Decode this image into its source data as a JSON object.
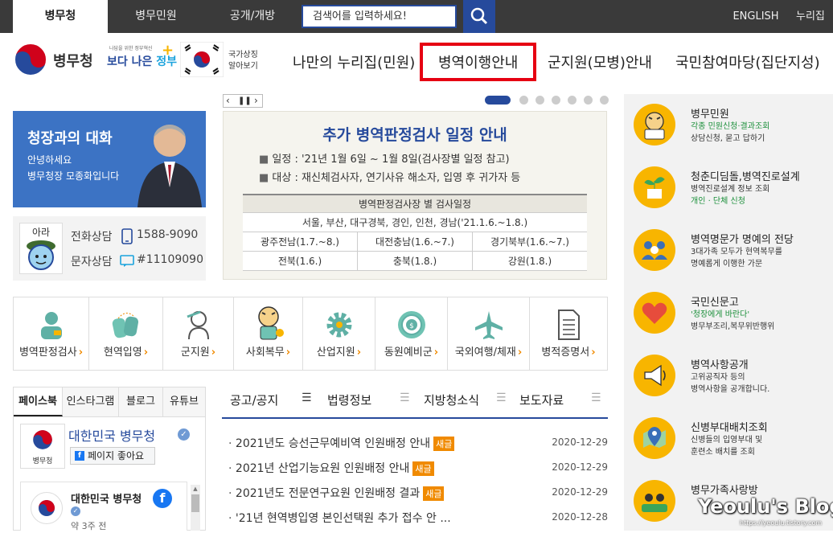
{
  "topbar": {
    "tabs": [
      "병무청",
      "병무민원",
      "공개/개방"
    ],
    "search_placeholder": "검색어를 입력하세요!",
    "english": "ENGLISH",
    "nuri": "누리집"
  },
  "header": {
    "logo_text": "병무청",
    "slogan_small": "나답을 위한 정부혁신",
    "slogan_big_a": "보다 나은 ",
    "slogan_big_b": "정부",
    "symbol_line1": "국가상징",
    "symbol_line2": "알아보기",
    "nav": [
      "나만의 누리집(민원)",
      "병역이행안내",
      "군지원(모병)안내",
      "국민참여마당(집단지성)"
    ]
  },
  "banner": {
    "title": "청장과의 대화",
    "line1": "안녕하세요",
    "line2": "병무청장 모종화입니다"
  },
  "contact": {
    "avatar_label": "아라",
    "phone_label": "전화상담",
    "phone": "1588-9090",
    "sms_label": "문자상담",
    "sms": "#11109090"
  },
  "slider": {
    "title": "추가 병역판정검사 일정 안내",
    "bullet1": "일정 : '21년 1월 6일 ~ 1월 8일(검사장별 일정 참고)",
    "bullet2": "대상 : 재신체검사자, 연기사유 해소자, 입영 후 귀가자 등",
    "table_title": "병역판정검사장 별 검사일정",
    "table_row1": "서울, 부산, 대구경북, 경인, 인천, 경남('21.1.6.~1.8.)",
    "table_grid": [
      [
        "광주전남(1.7.~8.)",
        "대전충남(1.6.~7.)",
        "경기북부(1.6.~7.)"
      ],
      [
        "전북(1.6.)",
        "충북(1.8.)",
        "강원(1.8.)"
      ]
    ]
  },
  "services": [
    {
      "label": "병역판정검사",
      "icon": "person-icon"
    },
    {
      "label": "현역입영",
      "icon": "dogtag-icon"
    },
    {
      "label": "군지원",
      "icon": "salute-icon"
    },
    {
      "label": "사회복무",
      "icon": "tiger-mascot-icon"
    },
    {
      "label": "산업지원",
      "icon": "gear-icon"
    },
    {
      "label": "동원예비군",
      "icon": "medal-icon"
    },
    {
      "label": "국외여행/체재",
      "icon": "airplane-icon"
    },
    {
      "label": "병적증명서",
      "icon": "document-icon"
    }
  ],
  "sns": {
    "tabs": [
      "페이스북",
      "인스타그램",
      "블로그",
      "유튜브"
    ],
    "page_name": "대한민국 병무청",
    "like": "페이지 좋아요",
    "logo_caption": "병무청",
    "post_name": "대한민국 병무청",
    "post_time": "약 3주 전"
  },
  "board": {
    "tabs": [
      "공고/공지",
      "법령정보",
      "지방청소식",
      "보도자료"
    ],
    "new_badge": "새글",
    "items": [
      {
        "title": "2021년도 승선근무예비역 인원배정 안내",
        "date": "2020-12-29",
        "new": true
      },
      {
        "title": "2021년 산업기능요원 인원배정 안내",
        "date": "2020-12-29",
        "new": true
      },
      {
        "title": "2021년도 전문연구요원 인원배정 결과",
        "date": "2020-12-29",
        "new": true
      },
      {
        "title": "'21년 현역병입영 본인선택원 추가 접수 안 ...",
        "date": "2020-12-28",
        "new": false
      }
    ]
  },
  "right": [
    {
      "title": "병무민원",
      "desc1": "각종 민원신청·결과조회",
      "desc2": "상담신청, 묻고 답하기",
      "icon": "tiger-mascot-icon"
    },
    {
      "title": "청춘디딤돌,병역진로설계",
      "desc1": "병역진로설계 정보 조회",
      "desc2": "개인 · 단체 신청",
      "icon": "sprout-icon"
    },
    {
      "title": "병역명문가 명예의 전당",
      "desc1": "3대가족 모두가 현역복무를",
      "desc2": "명예롭게 이행한 가문",
      "icon": "family-icon"
    },
    {
      "title": "국민신문고",
      "desc1": "'청장에게 바란다'",
      "desc2": "병무부조리,복무위반행위",
      "icon": "heart-icon"
    },
    {
      "title": "병역사항공개",
      "desc1": "고위공직자 등의",
      "desc2": "병역사항을 공개합니다.",
      "icon": "megaphone-icon"
    },
    {
      "title": "신병부대배치조회",
      "desc1": "신병들의 입영부대 및",
      "desc2": "훈련소 배치를 조회",
      "icon": "map-pin-icon"
    },
    {
      "title": "병무가족사랑방",
      "desc1": "",
      "desc2": "",
      "icon": "people-icon"
    }
  ],
  "watermark": {
    "title": "Yeoulu's Blog",
    "url": "https://yeoulu.tistory.com"
  },
  "colors": {
    "navy": "#264a9c",
    "orange": "#f08a00",
    "yellow": "#f8b500",
    "red": "#e60012"
  }
}
